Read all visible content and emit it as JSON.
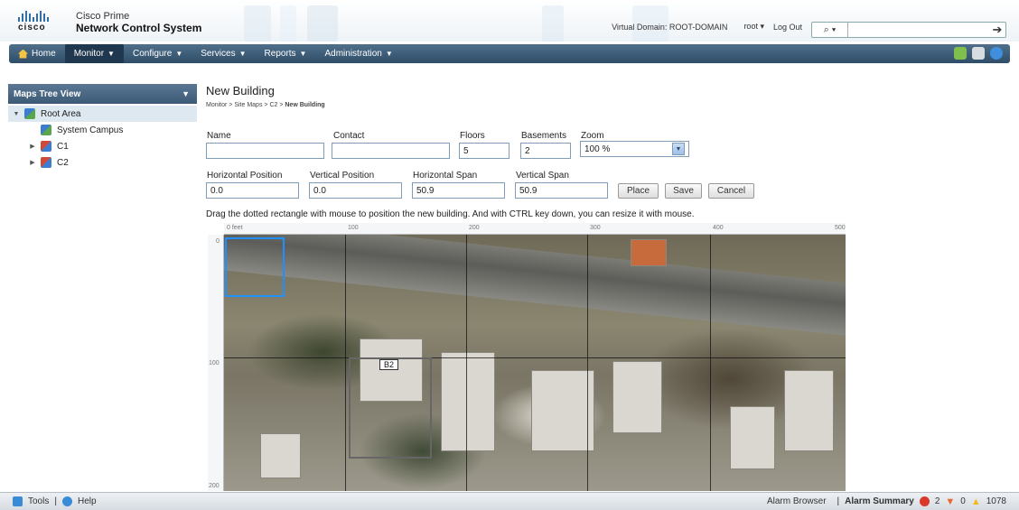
{
  "header": {
    "brand": "cisco",
    "product_line1": "Cisco Prime",
    "product_line2": "Network Control System",
    "virtual_domain": "Virtual Domain: ROOT-DOMAIN",
    "user": "root ▾",
    "logout": "Log Out",
    "search_icon": "⌕ ▾",
    "search_placeholder": "",
    "search_go": "➔"
  },
  "nav": {
    "items": [
      {
        "label": "Home",
        "caret": ""
      },
      {
        "label": "Monitor",
        "caret": "▼"
      },
      {
        "label": "Configure",
        "caret": "▼"
      },
      {
        "label": "Services",
        "caret": "▼"
      },
      {
        "label": "Reports",
        "caret": "▼"
      },
      {
        "label": "Administration",
        "caret": "▼"
      }
    ],
    "right_icons": [
      "settings-icon",
      "clipboard-icon",
      "help-icon"
    ]
  },
  "sidebar": {
    "title": "Maps Tree View",
    "chevron": "▼",
    "items": [
      {
        "label": "Root Area",
        "toggle": "▼"
      },
      {
        "label": "System Campus",
        "toggle": ""
      },
      {
        "label": "C1",
        "toggle": "▶"
      },
      {
        "label": "C2",
        "toggle": "▶"
      }
    ]
  },
  "main": {
    "title": "New Building",
    "breadcrumb": {
      "b1": "Monitor",
      "b2": "Site Maps",
      "b3": "C2",
      "current": "New Building",
      "sep": " > "
    },
    "fields": {
      "name": {
        "label": "Name",
        "value": ""
      },
      "contact": {
        "label": "Contact",
        "value": ""
      },
      "floors": {
        "label": "Floors",
        "value": "5"
      },
      "basements": {
        "label": "Basements",
        "value": "2"
      },
      "zoom": {
        "label": "Zoom",
        "value": "100 %"
      },
      "hpos": {
        "label": "Horizontal Position",
        "value": "0.0"
      },
      "vpos": {
        "label": "Vertical Position",
        "value": "0.0"
      },
      "hspan": {
        "label": "Horizontal Span",
        "value": "50.9"
      },
      "vspan": {
        "label": "Vertical Span",
        "value": "50.9"
      }
    },
    "buttons": {
      "place": "Place",
      "save": "Save",
      "cancel": "Cancel"
    },
    "instruction": "Drag the dotted rectangle with mouse to position the new building. And with CTRL key down, you can resize it with mouse."
  },
  "map": {
    "x_ticks": [
      "0 feet",
      "100",
      "200",
      "300",
      "400",
      "500"
    ],
    "y_ticks": [
      "0",
      "100",
      "200"
    ],
    "building_label": "B2"
  },
  "footer": {
    "tools": "Tools",
    "sep": "|",
    "help": "Help",
    "alarm_browser": "Alarm Browser",
    "alarm_summary": "Alarm Summary",
    "critical_count": "2",
    "major_count": "0",
    "minor_count": "1078",
    "critical_color": "#d93a2b",
    "major_color": "#e8682c",
    "minor_color": "#f2b81c"
  }
}
